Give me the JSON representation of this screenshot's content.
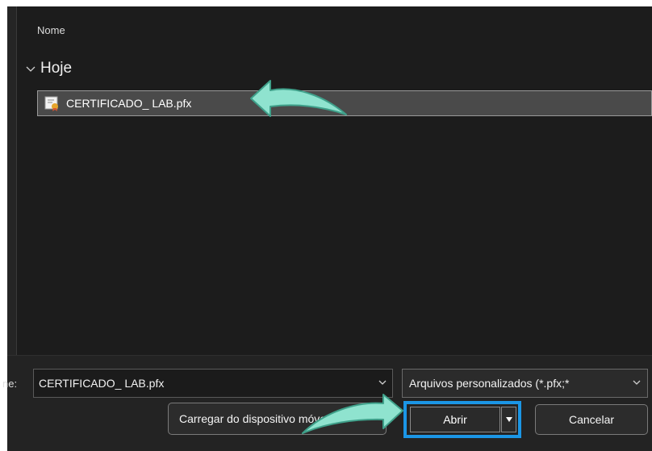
{
  "file_list": {
    "column_header": "Nome",
    "group_label": "Hoje",
    "files": [
      {
        "name": "CERTIFICADO_ LAB.pfx",
        "icon": "certificate-file-icon",
        "selected": true
      }
    ]
  },
  "footer": {
    "filename_label": "ne:",
    "filename_value": "CERTIFICADO_ LAB.pfx",
    "filter_value": "Arquivos personalizados (*.pfx;*",
    "upload_button": "Carregar do dispositivo móvel",
    "open_button": "Abrir",
    "cancel_button": "Cancelar"
  },
  "colors": {
    "highlight_frame": "#1b96e6",
    "annotation_arrow": "#8fe3cf",
    "window_background": "#1c1c1c"
  },
  "icons": [
    "chevron-down-icon",
    "certificate-file-icon",
    "dropdown-arrow-icon"
  ]
}
